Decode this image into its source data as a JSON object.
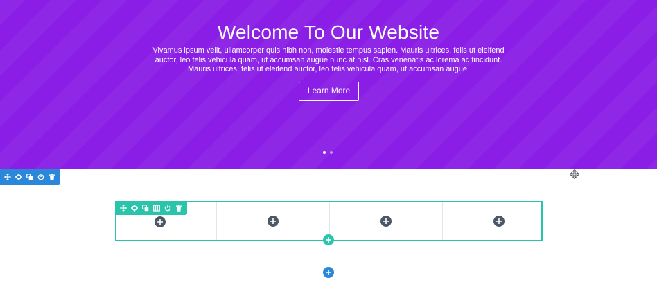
{
  "colors": {
    "hero_background": "#8a1de6",
    "section_toolbar": "#2b87da",
    "row_accent": "#29c4a9",
    "module_add": "#4c5866"
  },
  "hero": {
    "title": "Welcome To Our Website",
    "body": "Vivamus ipsum velit, ullamcorper quis nibh non, molestie tempus sapien. Mauris ultrices, felis ut eleifend auctor, leo felis vehicula quam, ut accumsan augue nunc at nisl. Cras venenatis ac lorema ac tincidunt. Mauris ultrices, felis ut eleifend auctor, leo felis vehicula quam, ut accumsan augue.",
    "button_label": "Learn More",
    "slides": 2,
    "active_slide": 1
  },
  "section_toolbar": {
    "icons": [
      "move-icon",
      "gear-icon",
      "duplicate-icon",
      "power-icon",
      "trash-icon"
    ]
  },
  "row_toolbar": {
    "icons": [
      "move-icon",
      "gear-icon",
      "duplicate-icon",
      "columns-icon",
      "power-icon",
      "trash-icon"
    ]
  },
  "row": {
    "columns": 4
  }
}
